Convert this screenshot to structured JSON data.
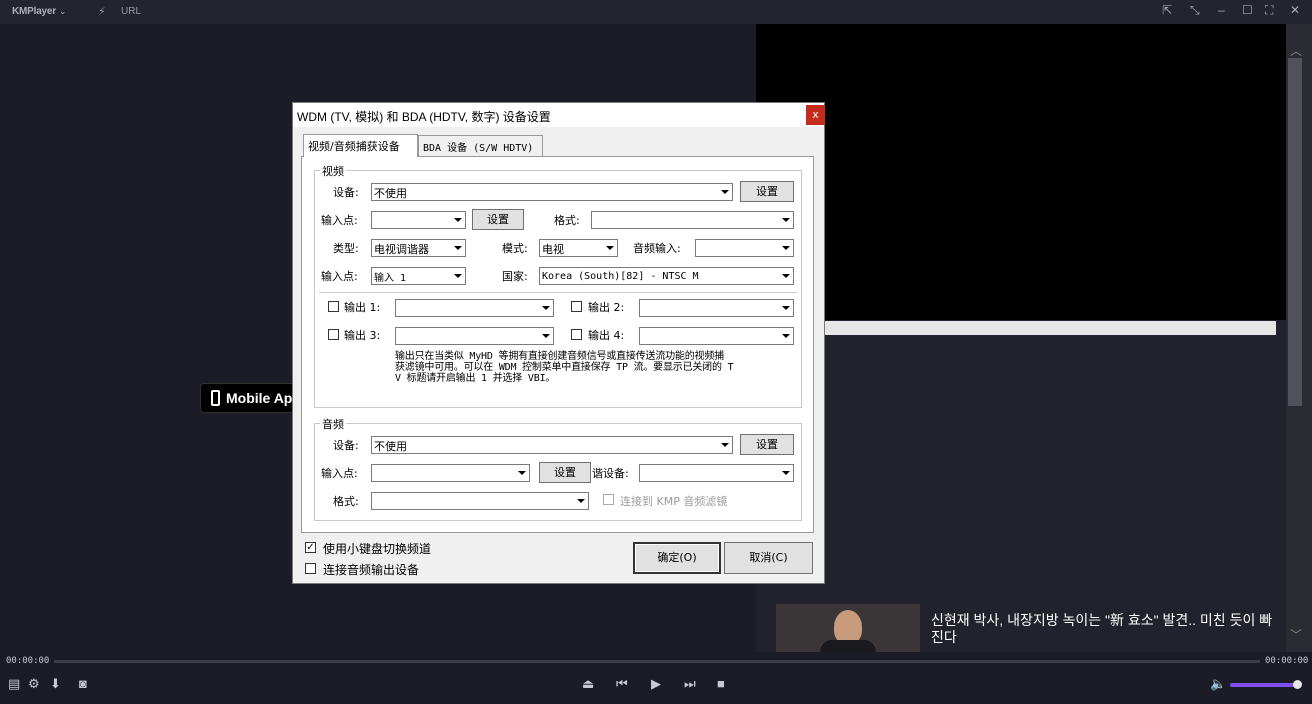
{
  "player": {
    "app_name": "KMPlayer",
    "menu_chevron": "⌄",
    "url_label": "URL",
    "time_left": "00:00:00",
    "time_right": "00:00:00",
    "mobile_app_label": "Mobile App",
    "news_headline": "신현재 박사, 내장지방 녹이는 \"新 효소\" 발견.. 미친 듯이 빠진다",
    "volume_percent": 100
  },
  "dialog": {
    "title": "WDM (TV, 模拟) 和 BDA (HDTV, 数字) 设备设置",
    "close_label": "x",
    "tabs": [
      "视频/音频捕获设备",
      "BDA 设备 (S/W HDTV)"
    ],
    "video": {
      "group_label": "视频",
      "device_label": "设备:",
      "device_value": "不使用",
      "device_settings": "设置",
      "input_label": "输入点:",
      "input_value": "",
      "input_settings": "设置",
      "format_label": "格式:",
      "format_value": "",
      "type_label": "类型:",
      "type_value": "电视调谐器",
      "mode_label": "模式:",
      "mode_value": "电视",
      "audio_input_label": "音频输入:",
      "audio_input_value": "",
      "input2_label": "输入点:",
      "input2_value": "输入 1",
      "country_label": "国家:",
      "country_value": "Korea (South)[82] - NTSC M",
      "outputs": [
        {
          "label": "输出 1:",
          "value": ""
        },
        {
          "label": "输出 2:",
          "value": ""
        },
        {
          "label": "输出 3:",
          "value": ""
        },
        {
          "label": "输出 4:",
          "value": ""
        }
      ],
      "note_line1": "输出只在当类似 MyHD 等拥有直接创建音频信号或直接传送流功能的视频捕",
      "note_line2": "获滤镜中可用。可以在 WDM 控制菜单中直接保存 TP 流。要显示已关闭的 T",
      "note_line3": "V 标题请开启输出 1 并选择 VBI。"
    },
    "audio": {
      "group_label": "音频",
      "device_label": "设备:",
      "device_value": "不使用",
      "device_settings": "设置",
      "input_label": "输入点:",
      "input_value": "",
      "input_settings": "设置",
      "tuner_label": "谐设备:",
      "tuner_value": "",
      "format_label": "格式:",
      "format_value": "",
      "connect_kmp_label": "连接到 KMP 音频滤镜"
    },
    "use_keypad_label": "使用小键盘切换频道",
    "use_keypad_checked": true,
    "connect_audio_out_label": "连接音频输出设备",
    "connect_audio_out_checked": false,
    "ok_label": "确定(O)",
    "cancel_label": "取消(C)"
  }
}
